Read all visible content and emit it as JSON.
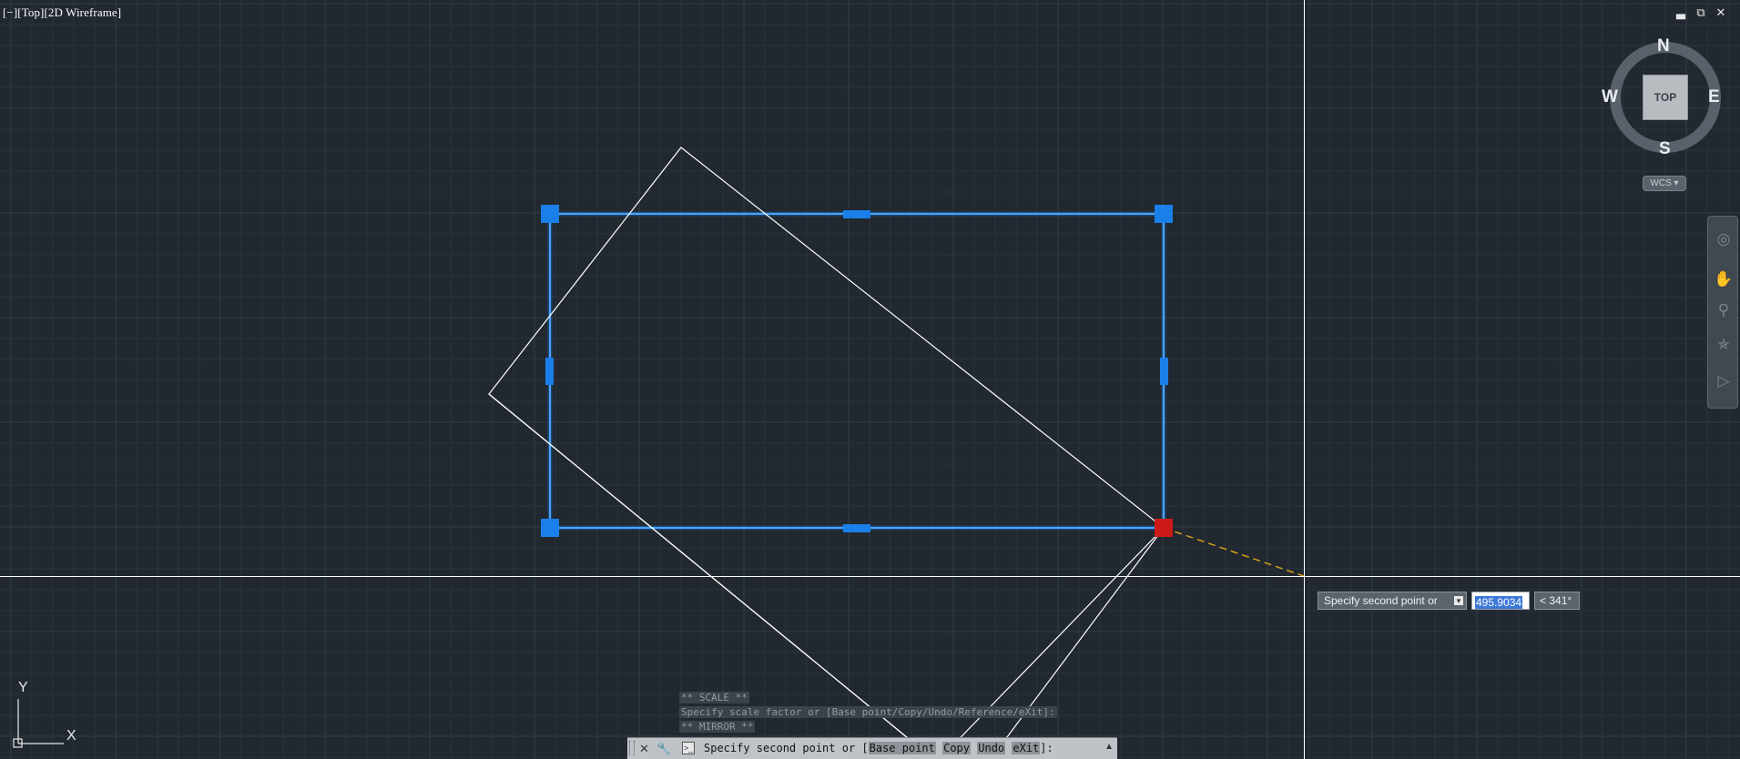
{
  "viewport": {
    "label": "[−][Top][2D Wireframe]"
  },
  "window_controls": {
    "minimize": "▃",
    "restore": "⧉",
    "close": "✕"
  },
  "viewcube": {
    "north": "N",
    "south": "S",
    "east": "E",
    "west": "W",
    "face": "TOP",
    "wcs_label": "WCS ▾"
  },
  "navbar": {
    "tools": [
      "steering-wheel-icon",
      "pan-icon",
      "zoom-icon",
      "orbit-icon",
      "showmotion-icon"
    ]
  },
  "dynamic_input": {
    "prompt": "Specify second point or",
    "distance_value": "495.9034",
    "angle_value": "< 341°"
  },
  "command_history": [
    "** SCALE **",
    "Specify scale factor or [Base point/Copy/Undo/Reference/eXit]:",
    "** MIRROR **"
  ],
  "command_line": {
    "prefix": "Specify second point or [",
    "options": [
      "Base point",
      "Copy",
      "Undo",
      "eXit"
    ],
    "suffix": "]:"
  },
  "ucs_icon": {
    "x_label": "X",
    "y_label": "Y"
  },
  "colors": {
    "background": "#212830",
    "grid_minor": "#2a323b",
    "grid_major": "#323b45",
    "selection": "#1a7fe8",
    "grip": "#1a7fe8",
    "hot_grip": "#cc1a1a",
    "rubber_band": "#d4a017",
    "crosshair": "#ffffff"
  }
}
